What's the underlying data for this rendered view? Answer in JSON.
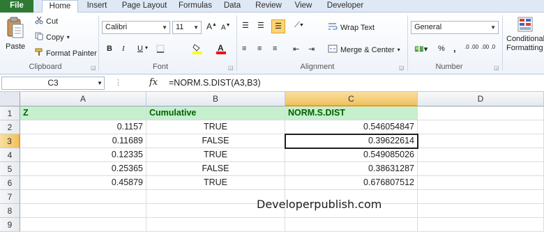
{
  "tabs": [
    "File",
    "Home",
    "Insert",
    "Page Layout",
    "Formulas",
    "Data",
    "Review",
    "View",
    "Developer"
  ],
  "clipboard": {
    "paste": "Paste",
    "cut": "Cut",
    "copy": "Copy",
    "format_painter": "Format Painter",
    "group_label": "Clipboard"
  },
  "font": {
    "name": "Calibri",
    "size": "11",
    "group_label": "Font",
    "bold": "B",
    "italic": "I",
    "underline": "U",
    "font_color": "#ff0000",
    "fill_color": "#ffff00"
  },
  "alignment": {
    "wrap_text": "Wrap Text",
    "merge_center": "Merge & Center",
    "group_label": "Alignment"
  },
  "number": {
    "format": "General",
    "percent": "%",
    "comma": ",",
    "dec_inc": ".0 .00",
    "dec_dec": ".00 .0",
    "group_label": "Number"
  },
  "styles": {
    "conditional": "Conditional",
    "formatting": "Formatting"
  },
  "formula_bar": {
    "name_box": "C3",
    "fx": "fx",
    "formula": "=NORM.S.DIST(A3,B3)"
  },
  "columns": [
    "A",
    "B",
    "C",
    "D"
  ],
  "rows": [
    "1",
    "2",
    "3",
    "4",
    "5",
    "6",
    "7",
    "8",
    "9"
  ],
  "header_row": {
    "a": "Z",
    "b": "Cumulative",
    "c": "NORM.S.DIST"
  },
  "data_rows": [
    {
      "a": "0.1157",
      "b": "TRUE",
      "c": "0.546054847"
    },
    {
      "a": "0.11689",
      "b": "FALSE",
      "c": "0.39622614"
    },
    {
      "a": "0.12335",
      "b": "TRUE",
      "c": "0.549085026"
    },
    {
      "a": "0.25365",
      "b": "FALSE",
      "c": "0.38631287"
    },
    {
      "a": "0.45879",
      "b": "TRUE",
      "c": "0.676807512"
    }
  ],
  "watermark": "Developerpublish.com",
  "colors": {
    "header_fill": "#c6efce",
    "header_text": "#006100",
    "file_tab": "#2e7a35",
    "selection": "#f1c15f"
  }
}
